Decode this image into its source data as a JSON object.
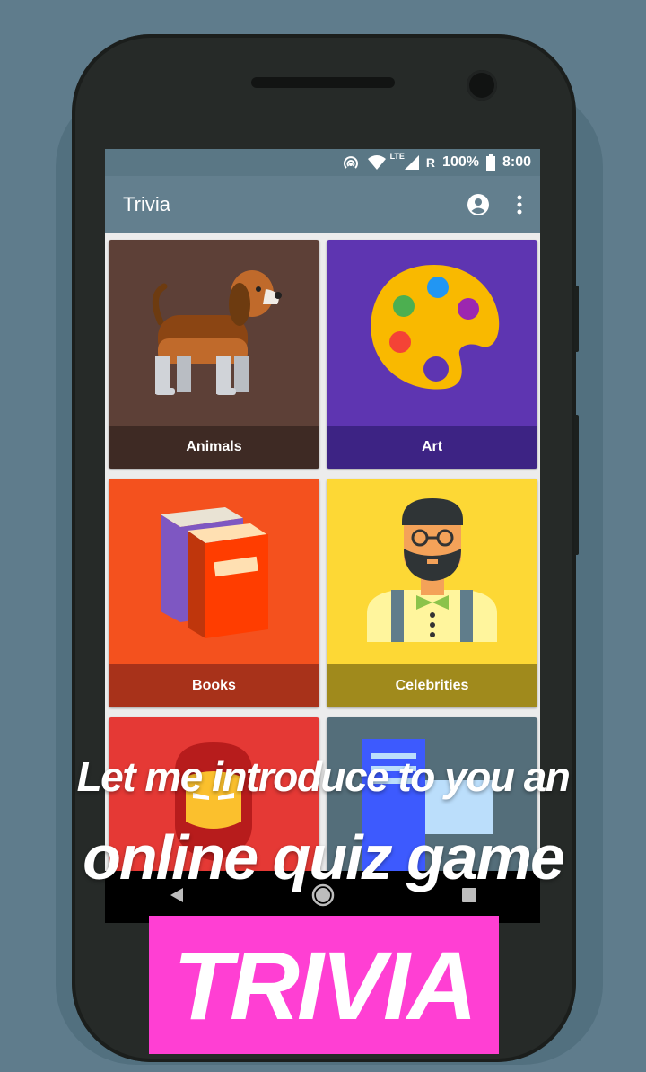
{
  "status_bar": {
    "network": "LTE",
    "roaming": "R",
    "battery": "100%",
    "time": "8:00"
  },
  "app_bar": {
    "title": "Trivia",
    "icons": [
      "account-circle-icon",
      "more-vert-icon"
    ]
  },
  "categories": [
    {
      "label": "Animals",
      "icon": "dog-icon",
      "color": "#5d4037",
      "label_bg": "#3e2a24"
    },
    {
      "label": "Art",
      "icon": "palette-icon",
      "color": "#5e35b1",
      "label_bg": "#3d2384"
    },
    {
      "label": "Books",
      "icon": "books-icon",
      "color": "#f4511e",
      "label_bg": "#a8321a"
    },
    {
      "label": "Celebrities",
      "icon": "person-icon",
      "color": "#fdd835",
      "label_bg": "#a08a1c"
    },
    {
      "label": "",
      "icon": "iron-man-icon",
      "color": "#e53935"
    },
    {
      "label": "",
      "icon": "computer-icon",
      "color": "#546e7a"
    }
  ],
  "nav_bar": {
    "icons": [
      "back-icon",
      "home-icon",
      "recents-icon"
    ]
  },
  "overlay": {
    "line1": "Let me introduce to you an",
    "line2": "online quiz game",
    "badge": "TRIVIA",
    "badge_color": "#ff3fd3"
  }
}
